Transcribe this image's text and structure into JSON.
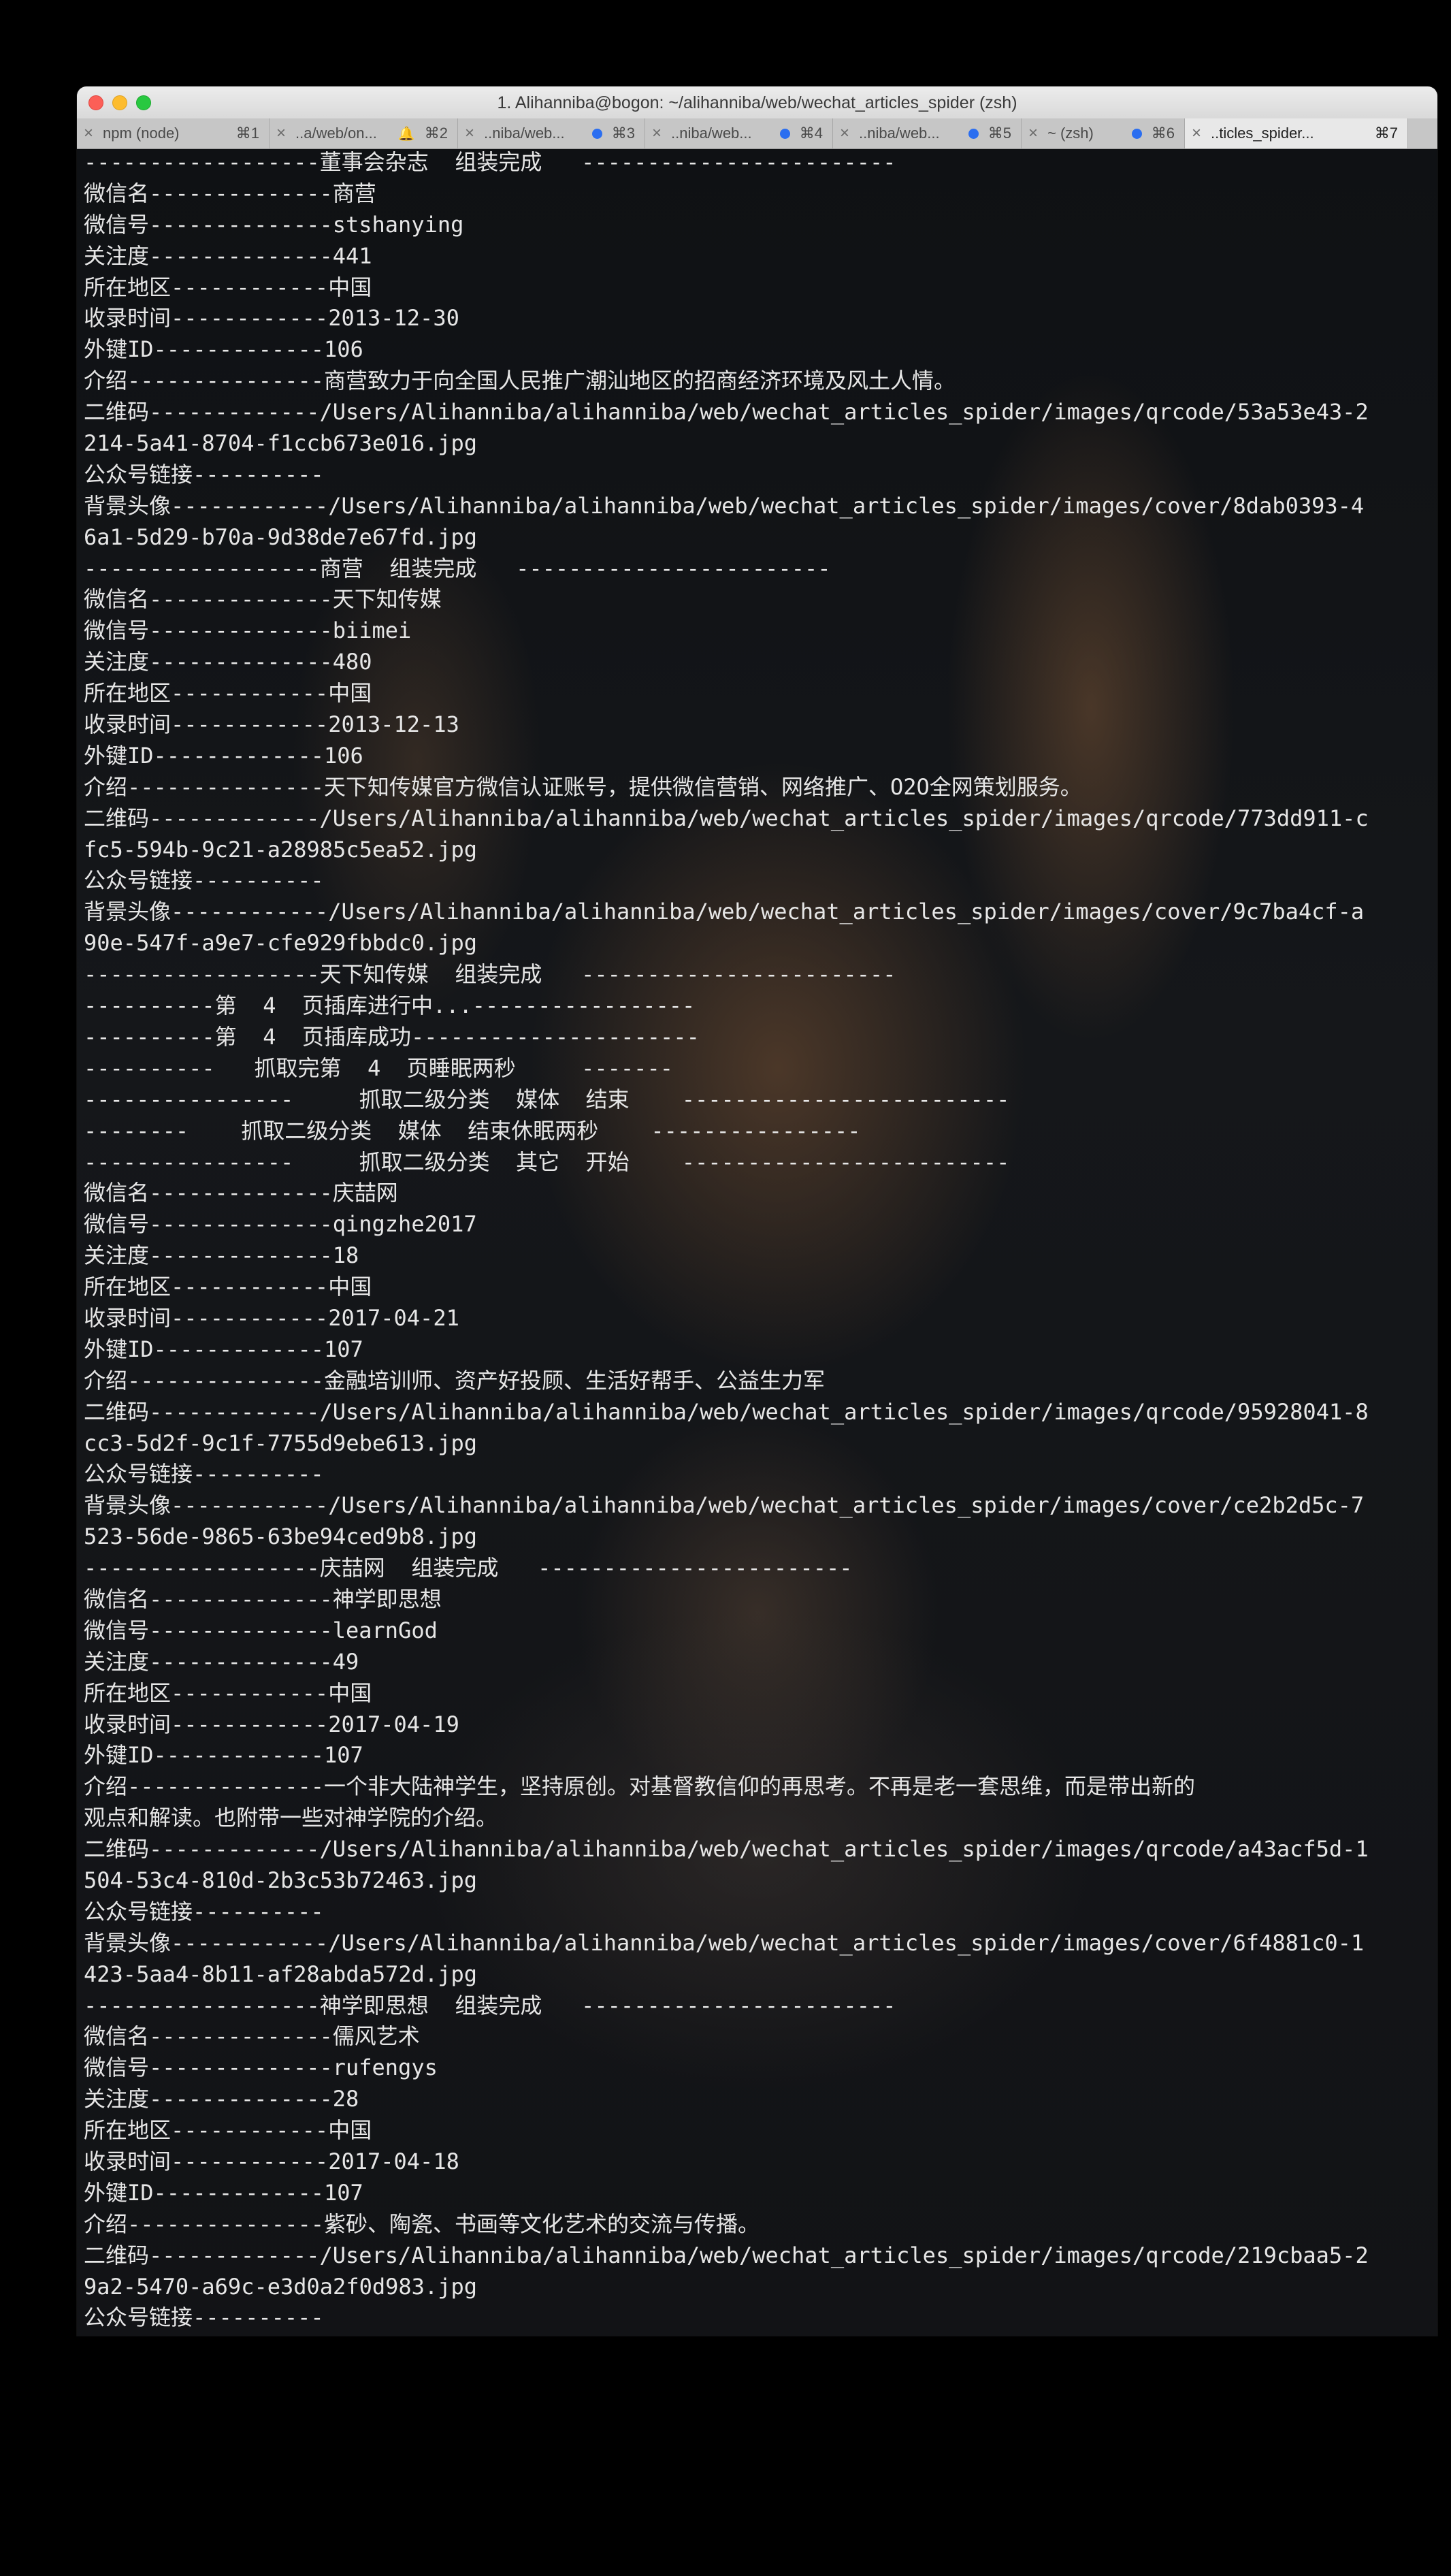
{
  "window": {
    "title": "1. Alihanniba@bogon: ~/alihanniba/web/wechat_articles_spider (zsh)"
  },
  "tabs": [
    {
      "label": "npm (node)",
      "shortcut": "⌘1",
      "has_dot": false,
      "has_bell": false,
      "active": false
    },
    {
      "label": "..a/web/on...",
      "shortcut": "⌘2",
      "has_dot": false,
      "has_bell": true,
      "active": false
    },
    {
      "label": "..niba/web...",
      "shortcut": "⌘3",
      "has_dot": true,
      "has_bell": false,
      "active": false
    },
    {
      "label": "..niba/web...",
      "shortcut": "⌘4",
      "has_dot": true,
      "has_bell": false,
      "active": false
    },
    {
      "label": "..niba/web...",
      "shortcut": "⌘5",
      "has_dot": true,
      "has_bell": false,
      "active": false
    },
    {
      "label": "~ (zsh)",
      "shortcut": "⌘6",
      "has_dot": true,
      "has_bell": false,
      "active": false
    },
    {
      "label": "..ticles_spider...",
      "shortcut": "⌘7",
      "has_dot": false,
      "has_bell": false,
      "active": true
    }
  ],
  "colors": {
    "tab_dot": "#2b6ef0",
    "terminal_text": "#e6e6e6"
  },
  "terminal": {
    "lines": [
      "------------------董事会杂志  组装完成   ------------------------",
      "微信名--------------商营",
      "微信号--------------stshanying",
      "关注度--------------441",
      "所在地区------------中国",
      "收录时间------------2013-12-30",
      "外键ID-------------106",
      "介绍---------------商营致力于向全国人民推广潮汕地区的招商经济环境及风土人情。",
      "二维码-------------/Users/Alihanniba/alihanniba/web/wechat_articles_spider/images/qrcode/53a53e43-2",
      "214-5a41-8704-f1ccb673e016.jpg",
      "公众号链接----------",
      "背景头像------------/Users/Alihanniba/alihanniba/web/wechat_articles_spider/images/cover/8dab0393-4",
      "6a1-5d29-b70a-9d38de7e67fd.jpg",
      "------------------商营  组装完成   ------------------------",
      "微信名--------------天下知传媒",
      "微信号--------------biimei",
      "关注度--------------480",
      "所在地区------------中国",
      "收录时间------------2013-12-13",
      "外键ID-------------106",
      "介绍---------------天下知传媒官方微信认证账号，提供微信营销、网络推广、O2O全网策划服务。",
      "二维码-------------/Users/Alihanniba/alihanniba/web/wechat_articles_spider/images/qrcode/773dd911-c",
      "fc5-594b-9c21-a28985c5ea52.jpg",
      "公众号链接----------",
      "背景头像------------/Users/Alihanniba/alihanniba/web/wechat_articles_spider/images/cover/9c7ba4cf-a",
      "90e-547f-a9e7-cfe929fbbdc0.jpg",
      "------------------天下知传媒  组装完成   ------------------------",
      "----------第  4  页插库进行中...-----------------",
      "----------第  4  页插库成功----------------------",
      "----------   抓取完第  4  页睡眠两秒     -------",
      "----------------     抓取二级分类  媒体  结束    -------------------------",
      "--------    抓取二级分类  媒体  结束休眠两秒    ----------------",
      "----------------     抓取二级分类  其它  开始    -------------------------",
      "微信名--------------庆喆网",
      "微信号--------------qingzhe2017",
      "关注度--------------18",
      "所在地区------------中国",
      "收录时间------------2017-04-21",
      "外键ID-------------107",
      "介绍---------------金融培训师、资产好投顾、生活好帮手、公益生力军",
      "二维码-------------/Users/Alihanniba/alihanniba/web/wechat_articles_spider/images/qrcode/95928041-8",
      "cc3-5d2f-9c1f-7755d9ebe613.jpg",
      "公众号链接----------",
      "背景头像------------/Users/Alihanniba/alihanniba/web/wechat_articles_spider/images/cover/ce2b2d5c-7",
      "523-56de-9865-63be94ced9b8.jpg",
      "------------------庆喆网  组装完成   ------------------------",
      "微信名--------------神学即思想",
      "微信号--------------learnGod",
      "关注度--------------49",
      "所在地区------------中国",
      "收录时间------------2017-04-19",
      "外键ID-------------107",
      "介绍---------------一个非大陆神学生，坚持原创。对基督教信仰的再思考。不再是老一套思维，而是带出新的",
      "观点和解读。也附带一些对神学院的介绍。",
      "二维码-------------/Users/Alihanniba/alihanniba/web/wechat_articles_spider/images/qrcode/a43acf5d-1",
      "504-53c4-810d-2b3c53b72463.jpg",
      "公众号链接----------",
      "背景头像------------/Users/Alihanniba/alihanniba/web/wechat_articles_spider/images/cover/6f4881c0-1",
      "423-5aa4-8b11-af28abda572d.jpg",
      "------------------神学即思想  组装完成   ------------------------",
      "微信名--------------儒风艺术",
      "微信号--------------rufengys",
      "关注度--------------28",
      "所在地区------------中国",
      "收录时间------------2017-04-18",
      "外键ID-------------107",
      "介绍---------------紫砂、陶瓷、书画等文化艺术的交流与传播。",
      "二维码-------------/Users/Alihanniba/alihanniba/web/wechat_articles_spider/images/qrcode/219cbaa5-2",
      "9a2-5470-a69c-e3d0a2f0d983.jpg",
      "公众号链接----------"
    ]
  }
}
